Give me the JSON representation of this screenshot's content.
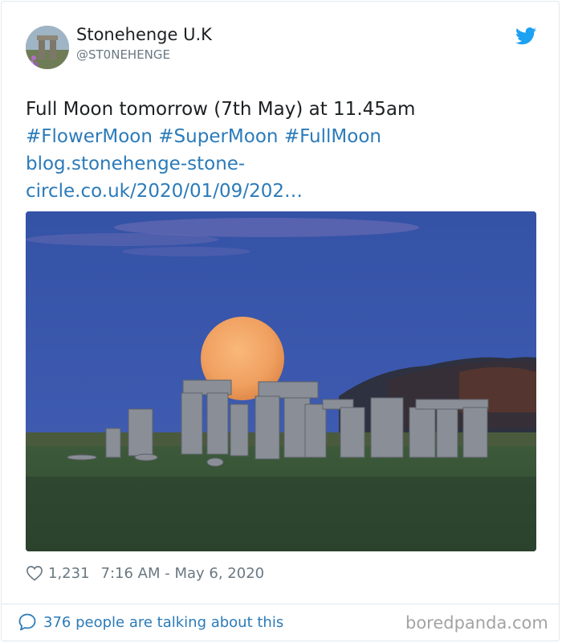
{
  "author": {
    "display_name": "Stonehenge U.K",
    "handle": "@ST0NEHENGE"
  },
  "tweet": {
    "line1": "Full Moon tomorrow (7th May) at 11.45am",
    "hashtags": [
      "#FlowerMoon",
      "#SuperMoon",
      "#FullMoon"
    ],
    "link_line1": "blog.stonehenge-stone-",
    "link_line2": "circle.co.uk/2020/01/09/202…"
  },
  "meta": {
    "likes": "1,231",
    "timestamp": "7:16 AM - May 6, 2020"
  },
  "footer": {
    "talking": "376 people are talking about this",
    "watermark": "boredpanda.com"
  },
  "colors": {
    "link": "#2b7bb9",
    "secondary_text": "#697882",
    "twitter_blue": "#1da1f2"
  },
  "icons": [
    "twitter-bird-icon",
    "heart-icon",
    "speech-bubble-icon"
  ]
}
